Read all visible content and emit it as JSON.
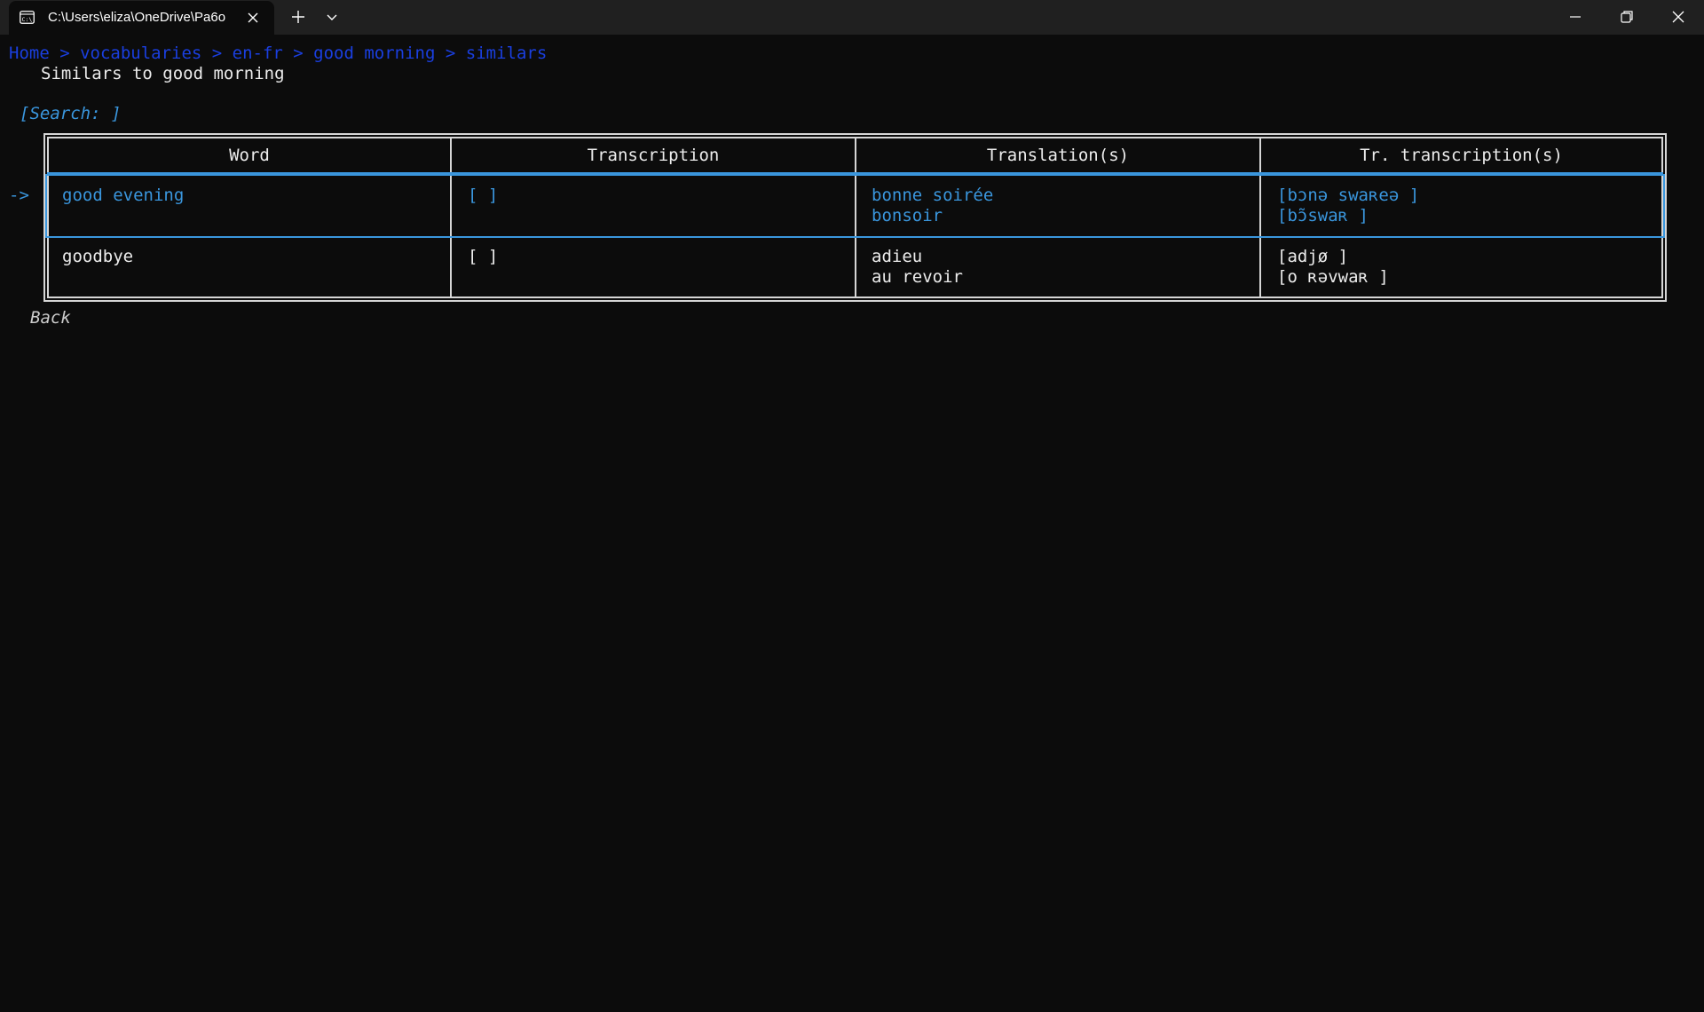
{
  "window": {
    "tab_title": "C:\\Users\\eliza\\OneDrive\\Pa6o"
  },
  "breadcrumb": {
    "text": "Home > vocabularies > en-fr > good morning > similars"
  },
  "page": {
    "title": "Similars to good morning",
    "search": "[Search: ]",
    "selection_marker": "->",
    "back_label": "Back"
  },
  "table": {
    "headers": [
      "Word",
      "Transcription",
      "Translation(s)",
      "Tr. transcription(s)"
    ],
    "rows": [
      {
        "word": "good evening",
        "transcription": "[ ]",
        "translations": [
          "bonne soirée",
          "bonsoir"
        ],
        "tr_transcriptions": [
          "[bɔnə swaʀeə ]",
          "[bɔ̃swaʀ ]"
        ],
        "selected": true
      },
      {
        "word": "goodbye",
        "transcription": "[ ]",
        "translations": [
          "adieu",
          "au revoir"
        ],
        "tr_transcriptions": [
          "[adjø ]",
          "[o ʀəvwaʀ ]"
        ],
        "selected": false
      }
    ]
  },
  "colors": {
    "background": "#0c0c0c",
    "titlebar": "#202020",
    "breadcrumb": "#1a3fe0",
    "accent": "#3a96dd",
    "text": "#ececec",
    "border": "#d6d6d6"
  },
  "icons": [
    "terminal-icon",
    "close-icon",
    "plus-icon",
    "chevron-down-icon",
    "minimize-icon",
    "maximize-icon",
    "window-close-icon"
  ]
}
